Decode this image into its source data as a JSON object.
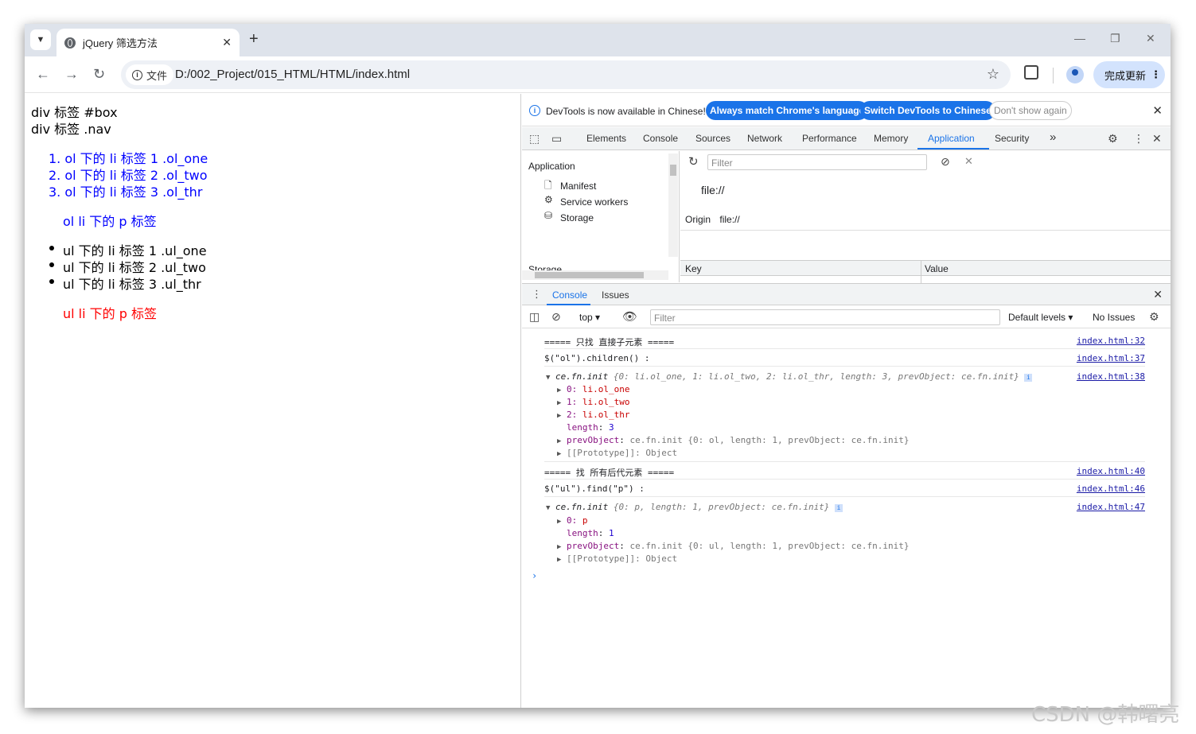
{
  "browser": {
    "tab_title": "jQuery 筛选方法",
    "tab_close": "✕",
    "new_tab": "+",
    "secure_chip_label": "文件",
    "url": "D:/002_Project/015_HTML/HTML/index.html",
    "update_button": "完成更新"
  },
  "page": {
    "lines": [
      {
        "text": "div 标签 #box",
        "color": "black"
      },
      {
        "text": "div 标签 .nav",
        "color": "black"
      },
      {
        "text": "1. ol 下的 li 标签 1 .ol_one",
        "color": "blue"
      },
      {
        "text": "2. ol 下的 li 标签 2 .ol_two",
        "color": "blue"
      },
      {
        "text": "3. ol 下的 li 标签 3 .ol_thr",
        "color": "blue"
      },
      {
        "text": "ol li 下的 p 标签",
        "color": "blue"
      },
      {
        "text": "ul 下的 li 标签 1 .ul_one",
        "color": "black"
      },
      {
        "text": "ul 下的 li 标签 2 .ul_two",
        "color": "black"
      },
      {
        "text": "ul 下的 li 标签 3 .ul_thr",
        "color": "black"
      },
      {
        "text": "ul li 下的 p 标签",
        "color": "red"
      }
    ]
  },
  "devtools": {
    "infobar": {
      "message": "DevTools is now available in Chinese!",
      "btn_match": "Always match Chrome's language",
      "btn_switch": "Switch DevTools to Chinese",
      "btn_dont_show": "Don't show again"
    },
    "tabs": [
      "Elements",
      "Console",
      "Sources",
      "Network",
      "Performance",
      "Memory",
      "Application",
      "Security"
    ],
    "active_tab": "Application",
    "more_tabs": "»",
    "application": {
      "header": "Application",
      "items": [
        "Manifest",
        "Service workers",
        "Storage"
      ],
      "cut_off_header": "Storage",
      "filter_placeholder": "Filter",
      "origin_big": "file://",
      "origin_label": "Origin",
      "origin_value": "file://",
      "col_key": "Key",
      "col_value": "Value"
    },
    "drawer": {
      "tabs": [
        "Console",
        "Issues"
      ],
      "context": "top",
      "filter_placeholder": "Filter",
      "levels": "Default levels",
      "issues": "No Issues"
    },
    "console": {
      "src": [
        "index.html:32",
        "index.html:37",
        "index.html:38",
        "index.html:40",
        "index.html:46",
        "index.html:47"
      ],
      "log1": "===== 只找 直接子元素 =====",
      "log2": "$(\"ol\").children() :",
      "obj1_head_name": "ce.fn.init",
      "obj1_head_body": "{0: li.ol_one, 1: li.ol_two, 2: li.ol_thr, length: 3, prevObject: ce.fn.init}",
      "obj1_items": [
        {
          "k": "0",
          "v": "li.ol_one"
        },
        {
          "k": "1",
          "v": "li.ol_two"
        },
        {
          "k": "2",
          "v": "li.ol_thr"
        }
      ],
      "length_key": "length",
      "obj1_length": "3",
      "prev_key": "prevObject",
      "obj1_prev": "ce.fn.init {0: ol, length: 1, prevObject: ce.fn.init}",
      "proto": "[[Prototype]]: Object",
      "log3": "===== 找 所有后代元素 =====",
      "log4": "$(\"ul\").find(\"p\") :",
      "obj2_head_body": "{0: p, length: 1, prevObject: ce.fn.init}",
      "obj2_item_k": "0",
      "obj2_item_v": "p",
      "obj2_length": "1",
      "obj2_prev": "ce.fn.init {0: ul, length: 1, prevObject: ce.fn.init}"
    }
  },
  "watermark": "CSDN @韩曙亮",
  "colors": {
    "accent": "#1a73e8",
    "blue_text": "#0000ff",
    "red_text": "#ff0000"
  }
}
